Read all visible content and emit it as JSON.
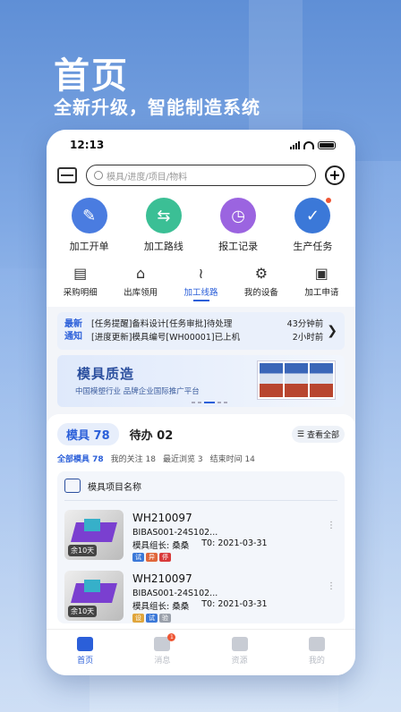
{
  "hero": {
    "title": "首页",
    "subtitle": "全新升级，智能制造系统"
  },
  "status": {
    "time": "12:13"
  },
  "search": {
    "placeholder": "模具/进度/项目/物料"
  },
  "big_icons": [
    {
      "label": "加工开单",
      "color": "#4a7ce0",
      "glyph": "✎"
    },
    {
      "label": "加工路线",
      "color": "#3bbf95",
      "glyph": "⇆"
    },
    {
      "label": "报工记录",
      "color": "#9b64e0",
      "glyph": "◷"
    },
    {
      "label": "生产任务",
      "color": "#3b78d8",
      "glyph": "✓"
    }
  ],
  "small_icons": [
    {
      "label": "采购明细",
      "glyph": "▤"
    },
    {
      "label": "出库领用",
      "glyph": "⌂"
    },
    {
      "label": "加工线路",
      "glyph": "≀"
    },
    {
      "label": "我的设备",
      "glyph": "⚙"
    },
    {
      "label": "加工申请",
      "glyph": "▣"
    }
  ],
  "notice": {
    "tag_line1": "最新",
    "tag_line2": "通知",
    "rows": [
      {
        "text": "[任务提醒]备料设计[任务审批]待处理",
        "time": "43分钟前"
      },
      {
        "text": "[进度更新]模具编号[WH00001]已上机",
        "time": "2小时前"
      }
    ]
  },
  "banner": {
    "title": "模具质造",
    "subtitle": "中国模塑行业  品牌企业国际推广平台"
  },
  "tabs": {
    "active": "模具 78",
    "inactive": "待办 02",
    "view_all": "查看全部"
  },
  "filters": [
    "全部模具 78",
    "我的关注 18",
    "最近浏览 3",
    "结束时间 14"
  ],
  "group_title": "模具项目名称",
  "items": [
    {
      "code": "WH210097",
      "part": "BIBAS001-24S102...",
      "leader": "模具组长: 桑桑",
      "stage": "T0:",
      "date": "2021-03-31",
      "days": "余10天",
      "badges": [
        {
          "text": "试",
          "color": "#3b78d8"
        },
        {
          "text": "异",
          "color": "#e0663a"
        },
        {
          "text": "停",
          "color": "#d83a3a"
        }
      ]
    },
    {
      "code": "WH210097",
      "part": "BIBAS001-24S102...",
      "leader": "模具组长: 桑桑",
      "stage": "T0:",
      "date": "2021-03-31",
      "days": "余10天",
      "badges": [
        {
          "text": "设",
          "color": "#e0a53a"
        },
        {
          "text": "试",
          "color": "#3b78d8"
        },
        {
          "text": "验",
          "color": "#9aa0aa"
        }
      ]
    }
  ],
  "tabbar": [
    {
      "label": "首页",
      "active": true
    },
    {
      "label": "消息",
      "badge": "1"
    },
    {
      "label": "资源"
    },
    {
      "label": "我的"
    }
  ]
}
